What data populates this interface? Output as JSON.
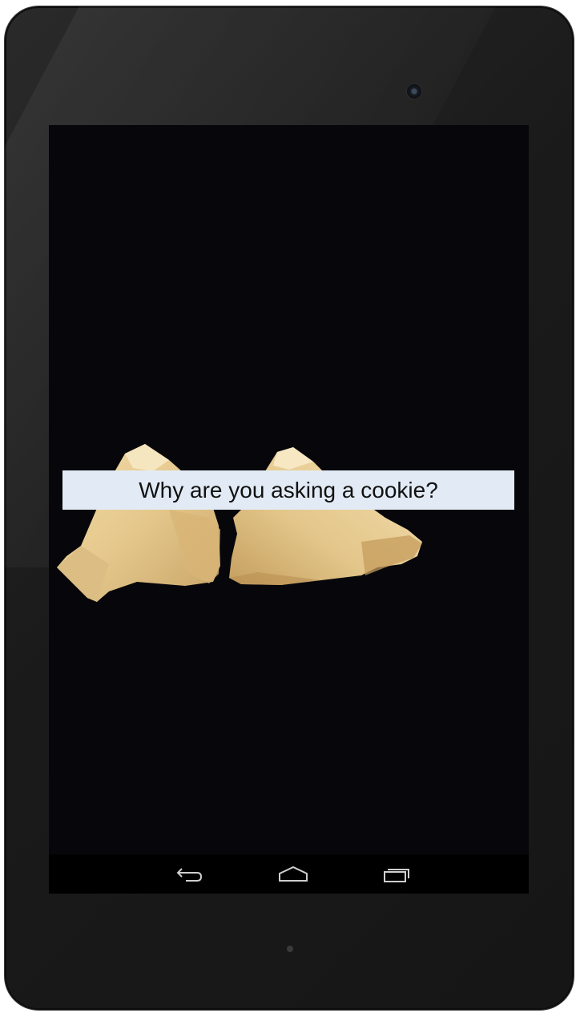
{
  "fortune": {
    "text": "Why are you asking a cookie?"
  },
  "navigation": {
    "buttons": [
      {
        "name": "back",
        "icon": "back-arrow-icon"
      },
      {
        "name": "home",
        "icon": "home-icon"
      },
      {
        "name": "recents",
        "icon": "recent-apps-icon"
      }
    ]
  },
  "colors": {
    "screen_background": "#07070b",
    "banner_background": "#e2ebf5",
    "cookie": "#e8cf96",
    "navbar": "#000000",
    "nav_icon": "#cfcfcf"
  }
}
